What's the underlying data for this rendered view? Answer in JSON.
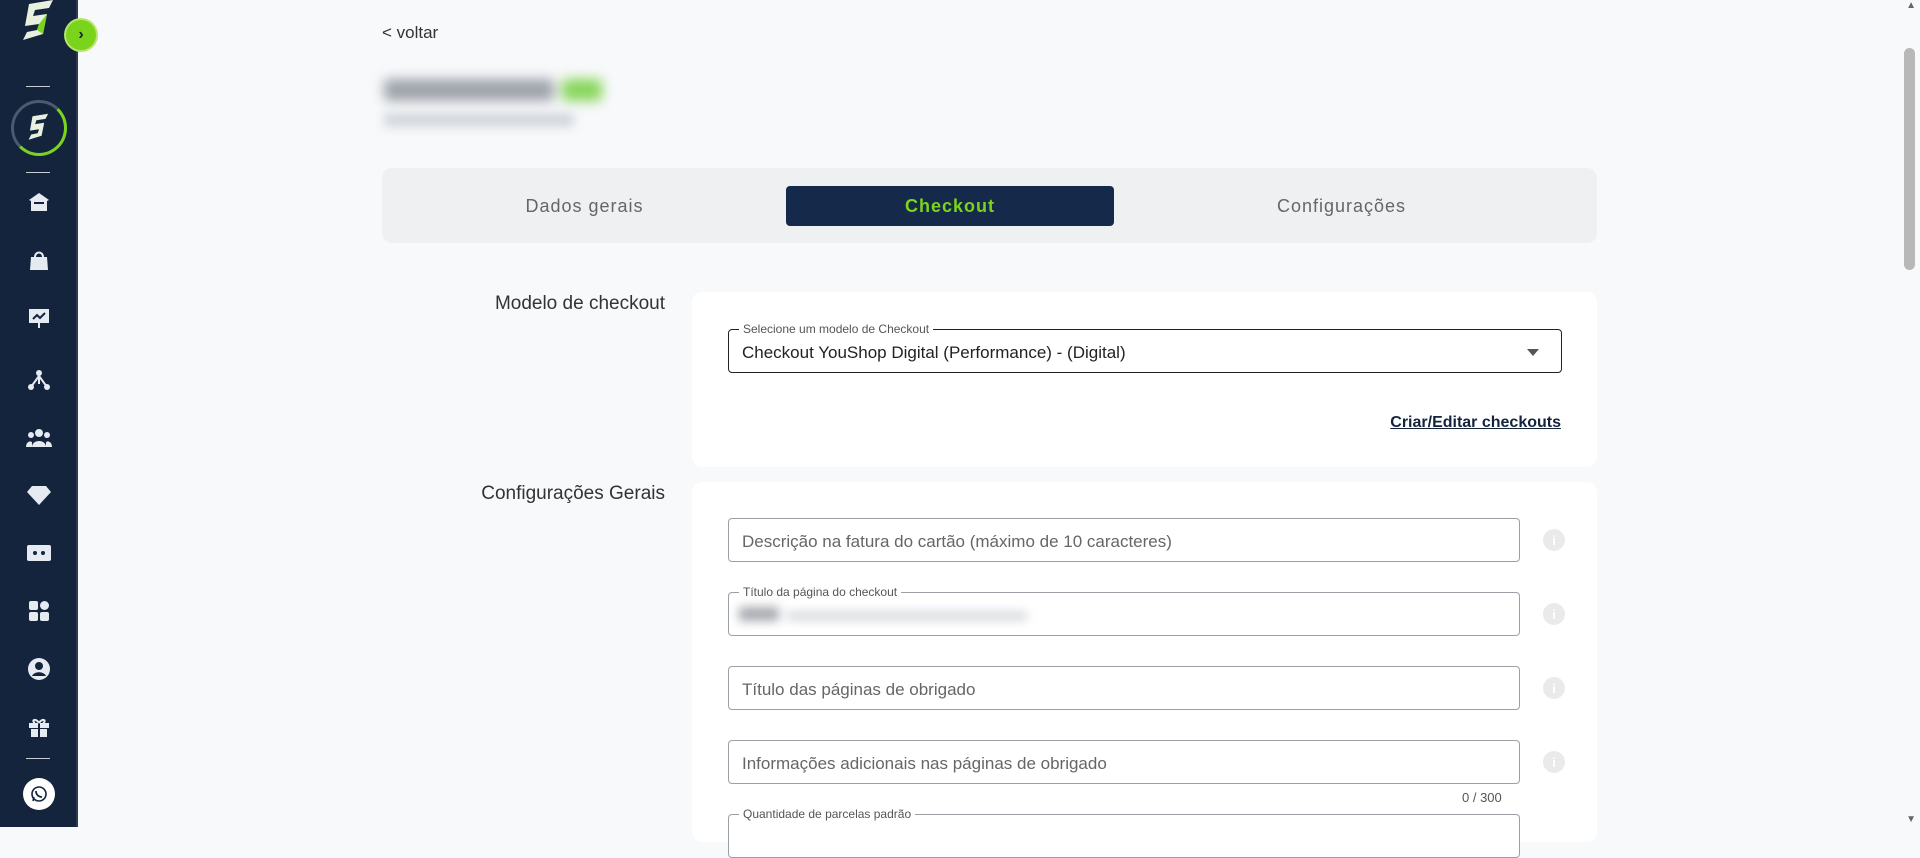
{
  "navigation": {
    "back_label": "< voltar"
  },
  "tabs": [
    {
      "label": "Dados gerais"
    },
    {
      "label": "Checkout"
    },
    {
      "label": "Configurações"
    }
  ],
  "checkout_model": {
    "section_label": "Modelo de checkout",
    "select_legend": "Selecione um modelo de Checkout",
    "select_value": "Checkout YouShop Digital (Performance) - (Digital)",
    "edit_link": "Criar/Editar checkouts"
  },
  "general_settings": {
    "section_label": "Configurações Gerais",
    "card_description_placeholder": "Descrição na fatura do cartão (máximo de 10 caracteres)",
    "page_title_legend": "Título da página do checkout",
    "thanks_title_placeholder": "Título das páginas de obrigado",
    "thanks_info_placeholder": "Informações adicionais nas páginas de obrigado",
    "thanks_info_counter": "0 / 300",
    "installments_legend": "Quantidade de parcelas padrão"
  },
  "colors": {
    "sidebar_bg": "#14243d",
    "accent_green": "#7bd41c",
    "active_tab_bg": "#152a4a"
  },
  "sidebar_icons": [
    "home-icon",
    "shopping-bag-icon",
    "presentation-chart-icon",
    "network-icon",
    "users-icon",
    "diamond-icon",
    "ticket-icon",
    "apps-grid-icon",
    "user-circle-icon",
    "gift-icon",
    "whatsapp-icon"
  ]
}
